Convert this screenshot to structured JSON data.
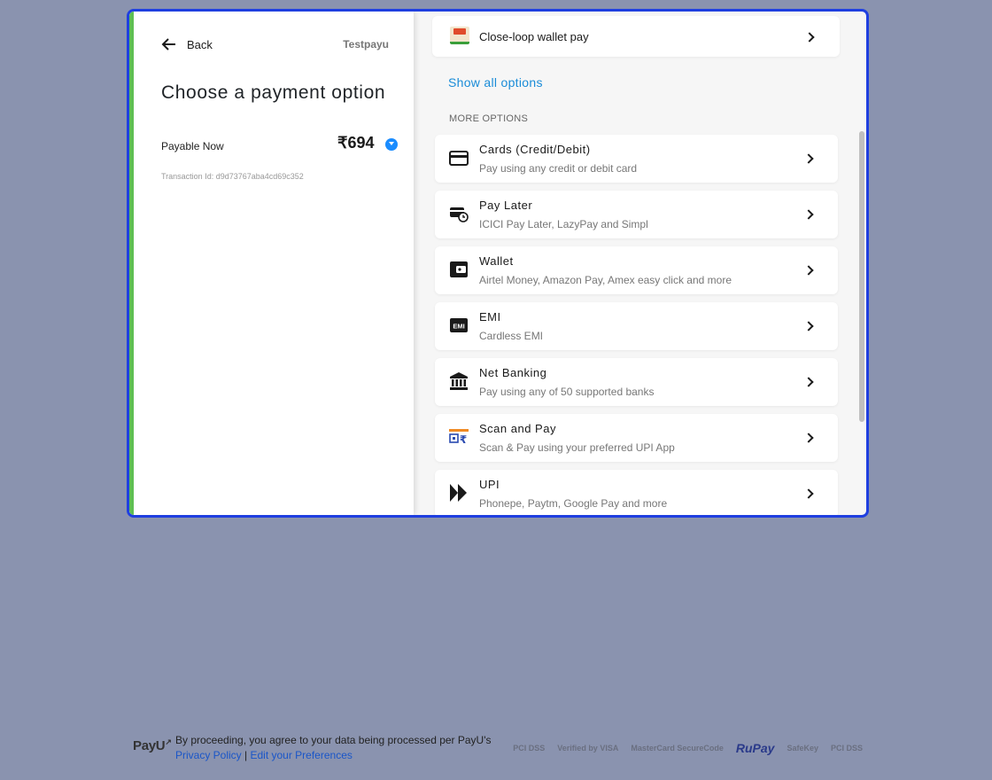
{
  "left": {
    "back_label": "Back",
    "merchant": "Testpayu",
    "title": "Choose a payment option",
    "payable_label": "Payable Now",
    "amount": "₹694",
    "transaction": "Transaction Id: d9d73767aba4cd69c352"
  },
  "right": {
    "closed_loop_label": "Close-loop wallet pay",
    "show_all": "Show all options",
    "more_options_heading": "MORE OPTIONS",
    "options": [
      {
        "title": "Cards (Credit/Debit)",
        "sub": "Pay using any credit or debit card",
        "icon": "card-icon"
      },
      {
        "title": "Pay Later",
        "sub": "ICICI Pay Later, LazyPay and Simpl",
        "icon": "pay-later-icon"
      },
      {
        "title": "Wallet",
        "sub": "Airtel Money, Amazon Pay, Amex easy click and more",
        "icon": "wallet-icon"
      },
      {
        "title": "EMI",
        "sub": "Cardless EMI",
        "icon": "emi-icon"
      },
      {
        "title": "Net Banking",
        "sub": "Pay using any of 50 supported banks",
        "icon": "bank-icon"
      },
      {
        "title": "Scan and Pay",
        "sub": "Scan & Pay using your preferred UPI App",
        "icon": "scan-pay-icon"
      },
      {
        "title": "UPI",
        "sub": "Phonepe, Paytm, Google Pay and more",
        "icon": "upi-icon"
      }
    ]
  },
  "footer": {
    "logo": "PayU",
    "consent_text": "By proceeding, you agree to your data being processed per PayU's ",
    "privacy_link": "Privacy Policy",
    "separator": " | ",
    "prefs_link": "Edit your Preferences",
    "badges": [
      "PCI DSS",
      "Verified by VISA",
      "MasterCard SecureCode",
      "RuPay",
      "SafeKey",
      "PCI DSS"
    ]
  },
  "colors": {
    "background": "#8a93af",
    "frame_border": "#1f3fe0",
    "accent_green": "#5fbf53",
    "link_blue": "#1a8cd8"
  }
}
